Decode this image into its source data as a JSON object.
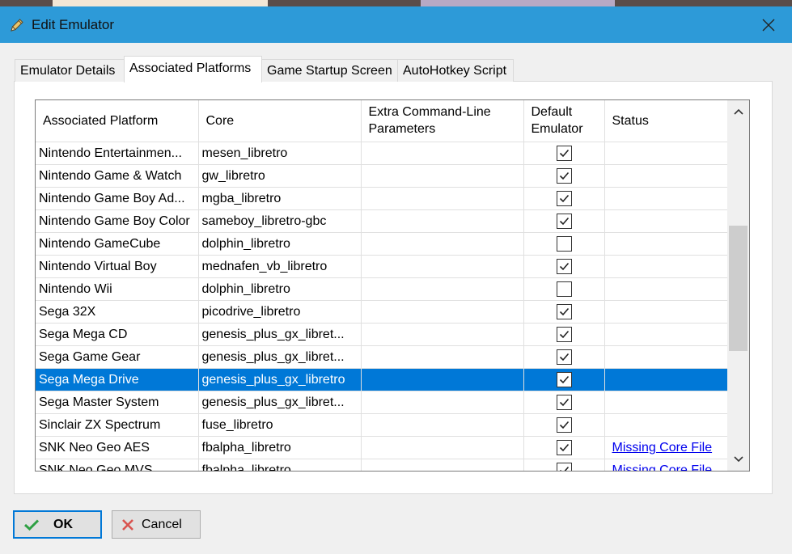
{
  "window": {
    "title": "Edit Emulator",
    "pencil_icon": "pencil-icon",
    "close_icon": "close-icon"
  },
  "tabs": [
    {
      "label": "Emulator Details"
    },
    {
      "label": "Associated Platforms",
      "active": true
    },
    {
      "label": "Game Startup Screen"
    },
    {
      "label": "AutoHotkey Script"
    }
  ],
  "grid": {
    "columns": [
      {
        "label": "Associated Platform"
      },
      {
        "label": "Core"
      },
      {
        "label": "Extra Command-Line Parameters"
      },
      {
        "label": "Default Emulator"
      },
      {
        "label": "Status"
      }
    ],
    "rows": [
      {
        "platform": "Nintendo Entertainmen...",
        "core": "mesen_libretro",
        "params": "",
        "default": true,
        "status": ""
      },
      {
        "platform": "Nintendo Game & Watch",
        "core": "gw_libretro",
        "params": "",
        "default": true,
        "status": ""
      },
      {
        "platform": "Nintendo Game Boy Ad...",
        "core": "mgba_libretro",
        "params": "",
        "default": true,
        "status": ""
      },
      {
        "platform": "Nintendo Game Boy Color",
        "core": "sameboy_libretro-gbc",
        "params": "",
        "default": true,
        "status": ""
      },
      {
        "platform": "Nintendo GameCube",
        "core": "dolphin_libretro",
        "params": "",
        "default": false,
        "status": ""
      },
      {
        "platform": "Nintendo Virtual Boy",
        "core": "mednafen_vb_libretro",
        "params": "",
        "default": true,
        "status": ""
      },
      {
        "platform": "Nintendo Wii",
        "core": "dolphin_libretro",
        "params": "",
        "default": false,
        "status": ""
      },
      {
        "platform": "Sega 32X",
        "core": "picodrive_libretro",
        "params": "",
        "default": true,
        "status": ""
      },
      {
        "platform": "Sega Mega CD",
        "core": "genesis_plus_gx_libret...",
        "params": "",
        "default": true,
        "status": ""
      },
      {
        "platform": "Sega Game Gear",
        "core": "genesis_plus_gx_libret...",
        "params": "",
        "default": true,
        "status": ""
      },
      {
        "platform": "Sega Mega Drive",
        "core": "genesis_plus_gx_libretro",
        "params": "",
        "default": true,
        "status": "",
        "selected": true
      },
      {
        "platform": "Sega Master System",
        "core": "genesis_plus_gx_libret...",
        "params": "",
        "default": true,
        "status": ""
      },
      {
        "platform": "Sinclair ZX Spectrum",
        "core": "fuse_libretro",
        "params": "",
        "default": true,
        "status": ""
      },
      {
        "platform": "SNK Neo Geo AES",
        "core": "fbalpha_libretro",
        "params": "",
        "default": true,
        "status": "Missing Core File"
      },
      {
        "platform": "SNK Neo Geo MVS",
        "core": "fbalpha_libretro",
        "params": "",
        "default": true,
        "status": "Missing Core File"
      }
    ]
  },
  "buttons": {
    "ok_label": "OK",
    "cancel_label": "Cancel"
  },
  "colors": {
    "titlebar": "#2d9ad8",
    "selection": "#0078d7",
    "link": "#0000ee"
  }
}
